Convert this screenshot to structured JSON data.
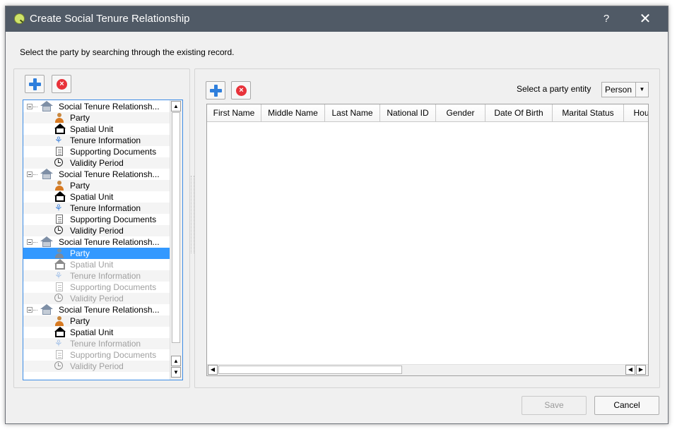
{
  "window": {
    "title": "Create Social Tenure Relationship",
    "help_label": "?",
    "close_label": "✕"
  },
  "instruction": "Select the party by searching through the existing record.",
  "tree": {
    "groups": [
      {
        "label": "Social Tenure Relationsh...",
        "children": [
          {
            "label": "Party",
            "icon": "party-icon",
            "faded": false
          },
          {
            "label": "Spatial Unit",
            "icon": "spatial-unit-icon",
            "faded": false
          },
          {
            "label": "Tenure Information",
            "icon": "tenure-icon",
            "faded": false
          },
          {
            "label": "Supporting Documents",
            "icon": "document-icon",
            "faded": false
          },
          {
            "label": "Validity Period",
            "icon": "clock-icon",
            "faded": false
          }
        ]
      },
      {
        "label": "Social Tenure Relationsh...",
        "children": [
          {
            "label": "Party",
            "icon": "party-icon",
            "faded": false
          },
          {
            "label": "Spatial Unit",
            "icon": "spatial-unit-icon",
            "faded": false
          },
          {
            "label": "Tenure Information",
            "icon": "tenure-icon",
            "faded": false
          },
          {
            "label": "Supporting Documents",
            "icon": "document-icon",
            "faded": false
          },
          {
            "label": "Validity Period",
            "icon": "clock-icon",
            "faded": false
          }
        ]
      },
      {
        "label": "Social Tenure Relationsh...",
        "children": [
          {
            "label": "Party",
            "icon": "party-icon",
            "faded": false,
            "selected": true
          },
          {
            "label": "Spatial Unit",
            "icon": "spatial-unit-icon",
            "faded": true
          },
          {
            "label": "Tenure Information",
            "icon": "tenure-icon",
            "faded": true
          },
          {
            "label": "Supporting Documents",
            "icon": "document-icon",
            "faded": true
          },
          {
            "label": "Validity Period",
            "icon": "clock-icon",
            "faded": true
          }
        ]
      },
      {
        "label": "Social Tenure Relationsh...",
        "children": [
          {
            "label": "Party",
            "icon": "party-icon",
            "faded": false
          },
          {
            "label": "Spatial Unit",
            "icon": "spatial-unit-icon",
            "faded": false
          },
          {
            "label": "Tenure Information",
            "icon": "tenure-icon",
            "faded": true
          },
          {
            "label": "Supporting Documents",
            "icon": "document-icon",
            "faded": true
          },
          {
            "label": "Validity Period",
            "icon": "clock-icon",
            "faded": true
          }
        ]
      }
    ]
  },
  "party_panel": {
    "entity_label": "Select a party entity",
    "entity_value": "Person",
    "columns": [
      "First Name",
      "Middle Name",
      "Last Name",
      "National ID",
      "Gender",
      "Date Of Birth",
      "Marital Status",
      "Hou"
    ]
  },
  "buttons": {
    "save": "Save",
    "cancel": "Cancel"
  },
  "colors": {
    "titlebar": "#505a66",
    "selection": "#3399ff",
    "add_icon": "#2f7fdc",
    "remove_icon": "#e8323a"
  }
}
